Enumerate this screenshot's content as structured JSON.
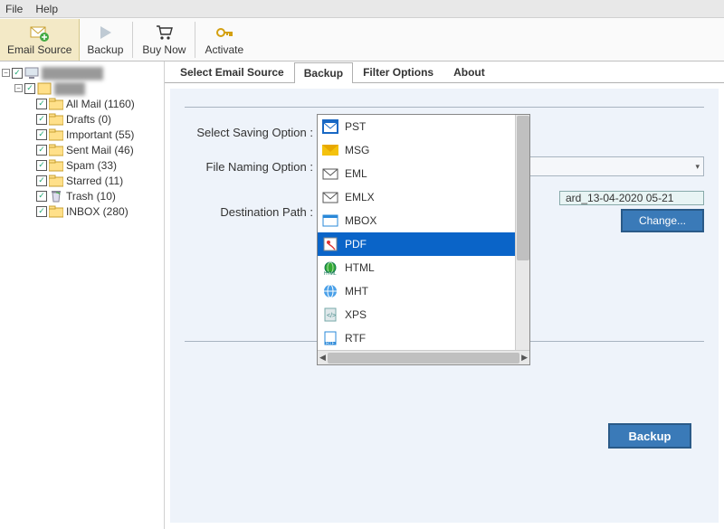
{
  "menu": {
    "file": "File",
    "help": "Help"
  },
  "toolbar": {
    "email_source": "Email Source",
    "backup": "Backup",
    "buy_now": "Buy Now",
    "activate": "Activate"
  },
  "tree": {
    "root_obscured": "████████",
    "sub_obscured": "████",
    "items": [
      {
        "label": "All Mail (1160)"
      },
      {
        "label": "Drafts (0)"
      },
      {
        "label": "Important (55)"
      },
      {
        "label": "Sent Mail (46)"
      },
      {
        "label": "Spam (33)"
      },
      {
        "label": "Starred (11)"
      },
      {
        "label": "Trash (10)"
      },
      {
        "label": "INBOX (280)"
      }
    ]
  },
  "tabs": {
    "select_source": "Select Email Source",
    "backup": "Backup",
    "filter": "Filter Options",
    "about": "About"
  },
  "form": {
    "saving_label": "Select Saving Option :",
    "saving_value": "PDF",
    "naming_label": "File Naming Option :",
    "dest_label": "Destination Path :",
    "dest_value": "ard_13-04-2020 05-21",
    "change": "Change...",
    "backup_btn": "Backup"
  },
  "dropdown": {
    "items": [
      {
        "label": "PST",
        "icon": "pst"
      },
      {
        "label": "MSG",
        "icon": "msg"
      },
      {
        "label": "EML",
        "icon": "eml"
      },
      {
        "label": "EMLX",
        "icon": "eml"
      },
      {
        "label": "MBOX",
        "icon": "mbox"
      },
      {
        "label": "PDF",
        "icon": "pdf",
        "selected": true
      },
      {
        "label": "HTML",
        "icon": "html"
      },
      {
        "label": "MHT",
        "icon": "mht"
      },
      {
        "label": "XPS",
        "icon": "xps"
      },
      {
        "label": "RTF",
        "icon": "rtf"
      }
    ]
  }
}
